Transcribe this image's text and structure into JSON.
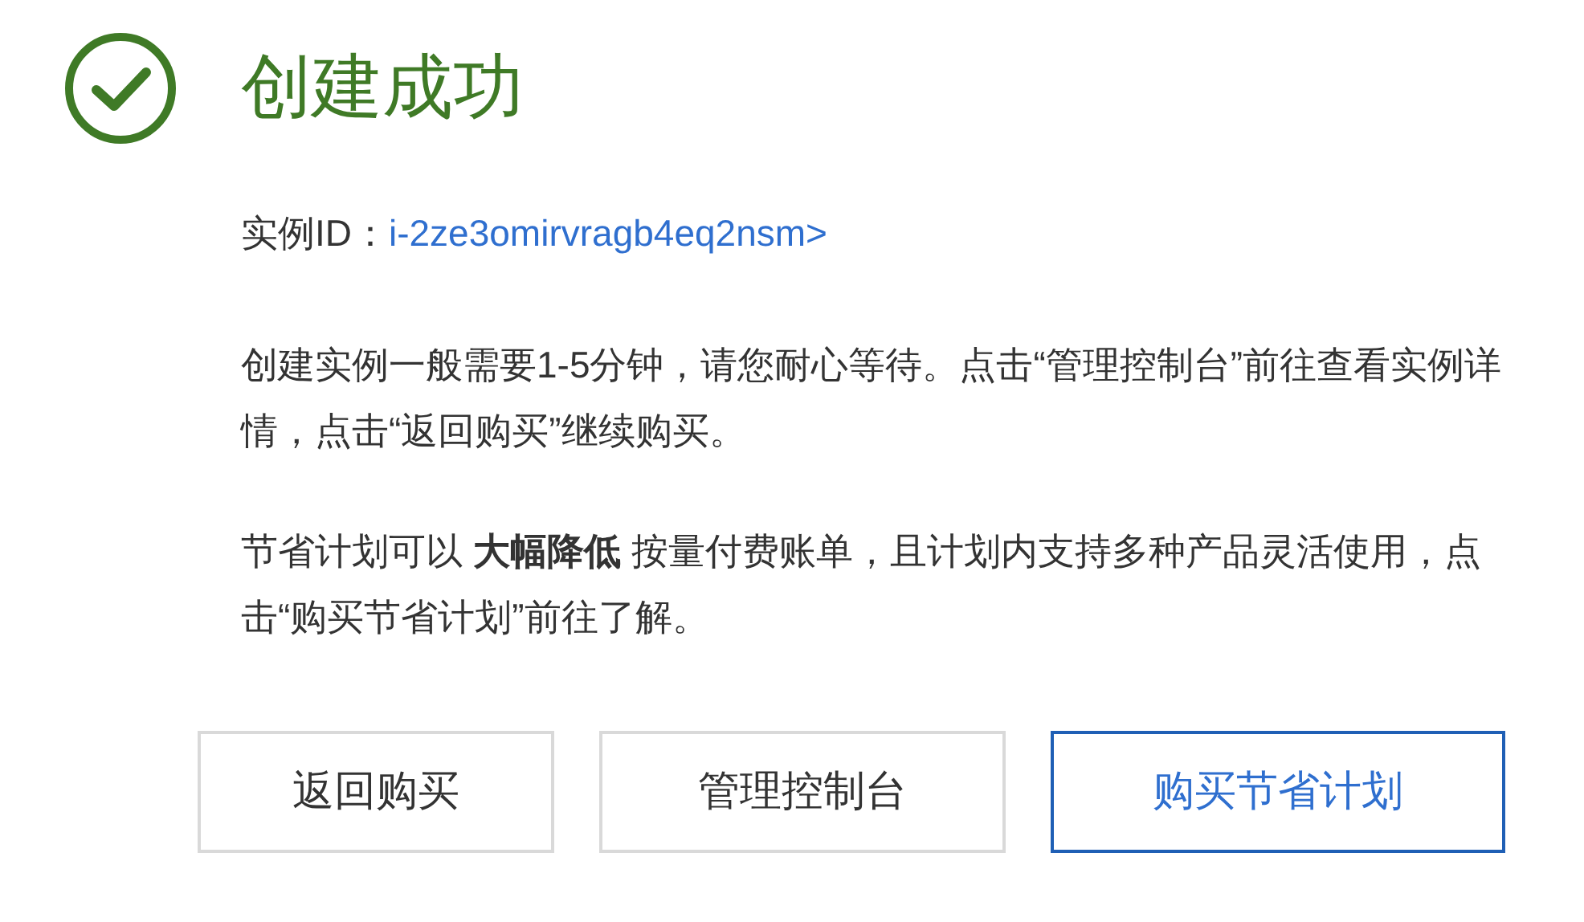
{
  "title": "创建成功",
  "instance": {
    "label": "实例ID：",
    "value": "i-2ze3omirvragb4eq2nsm>"
  },
  "paragraphs": [
    "创建实例一般需要1-5分钟，请您耐心等待。点击“管理控制台”前往查看实例详情，点击“返回购买”继续购买。",
    "节省计划可以 **大幅降低** 按量付费账单，且计划内支持多种产品灵活使用，点击“购买节省计划”前往了解。"
  ],
  "buttons": [
    {
      "label": "返回购买",
      "kind": "default"
    },
    {
      "label": "管理控制台",
      "kind": "default"
    },
    {
      "label": "购买节省计划",
      "kind": "primary"
    }
  ]
}
